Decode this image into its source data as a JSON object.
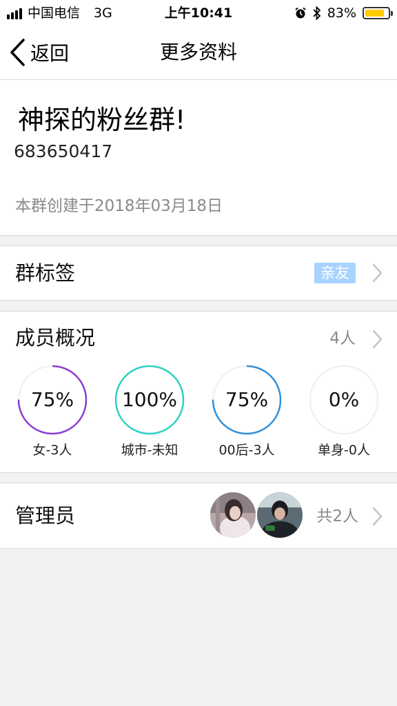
{
  "status_bar": {
    "carrier": "中国电信",
    "network": "3G",
    "time": "上午10:41",
    "battery_text": "83%",
    "battery_level": 0.83,
    "icons": [
      "signal-icon",
      "alarm-icon",
      "bluetooth-icon",
      "battery-icon"
    ]
  },
  "nav": {
    "back_label": "返回",
    "title": "更多资料"
  },
  "group": {
    "name": "神探的粉丝群!",
    "id": "683650417",
    "created": "本群创建于2018年03月18日"
  },
  "tags_section": {
    "label": "群标签",
    "tag": "亲友"
  },
  "members_section": {
    "label": "成员概况",
    "count": "4人",
    "stats": [
      {
        "percent_text": "75%",
        "value": 0.75,
        "label": "女-3人",
        "color": "#8a3ed1"
      },
      {
        "percent_text": "100%",
        "value": 1.0,
        "label": "城市-未知",
        "color": "#2cd0c4"
      },
      {
        "percent_text": "75%",
        "value": 0.75,
        "label": "00后-3人",
        "color": "#2f8fdc"
      },
      {
        "percent_text": "0%",
        "value": 0.0,
        "label": "单身-0人",
        "color": "#e6e6e6"
      }
    ]
  },
  "admins_section": {
    "label": "管理员",
    "count": "共2人"
  },
  "colors": {
    "tag_bg": "#a9d3ff",
    "secondary_text": "#8a8a8a",
    "page_bg": "#f2f2f5",
    "battery": "#ffcc00"
  }
}
